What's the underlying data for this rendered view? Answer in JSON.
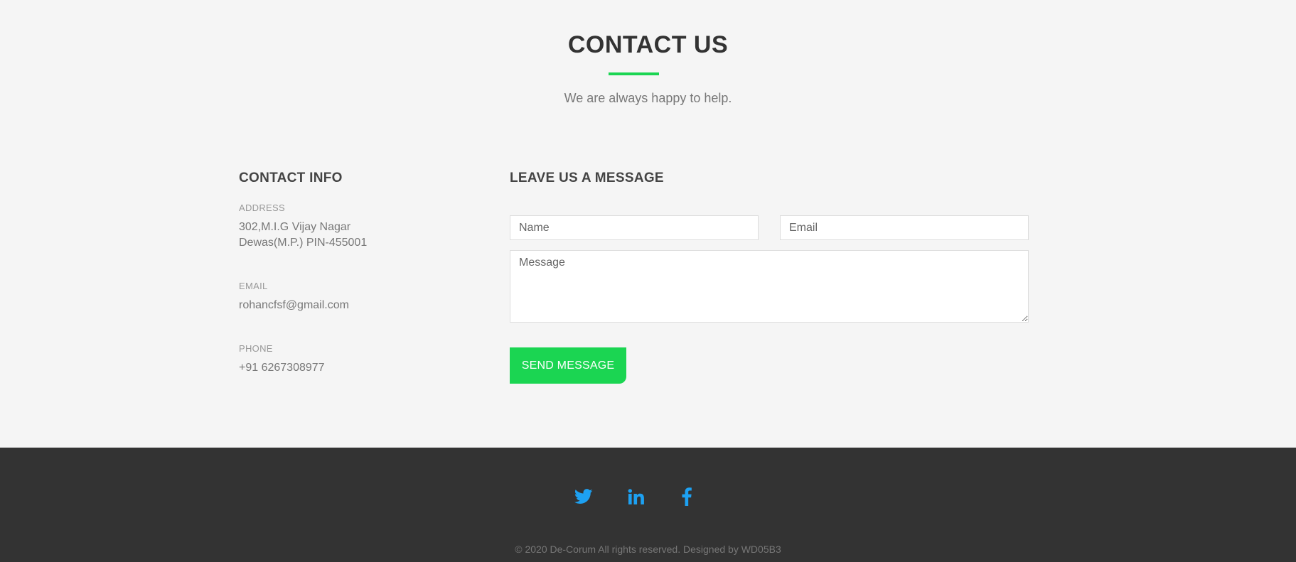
{
  "header": {
    "title": "CONTACT US",
    "subtitle": "We are always happy to help."
  },
  "contact_info": {
    "heading": "CONTACT INFO",
    "address_label": "ADDRESS",
    "address_line1": "302,M.I.G Vijay Nagar",
    "address_line2": "Dewas(M.P.) PIN-455001",
    "email_label": "EMAIL",
    "email_value": "rohancfsf@gmail.com",
    "phone_label": "PHONE",
    "phone_value": "+91 6267308977"
  },
  "form": {
    "heading": "LEAVE US A MESSAGE",
    "name_placeholder": "Name",
    "email_placeholder": "Email",
    "message_placeholder": "Message",
    "submit_label": "SEND MESSAGE"
  },
  "footer": {
    "social": [
      {
        "icon": "twitter-icon"
      },
      {
        "icon": "linkedin-icon"
      },
      {
        "icon": "facebook-icon"
      }
    ],
    "copyright": "© 2020 De-Corum All rights reserved. Designed by WD05B3"
  },
  "colors": {
    "accent": "#1bd552",
    "social_icon": "#1da1f2",
    "footer_bg": "#333333",
    "page_bg": "#f5f5f5"
  }
}
